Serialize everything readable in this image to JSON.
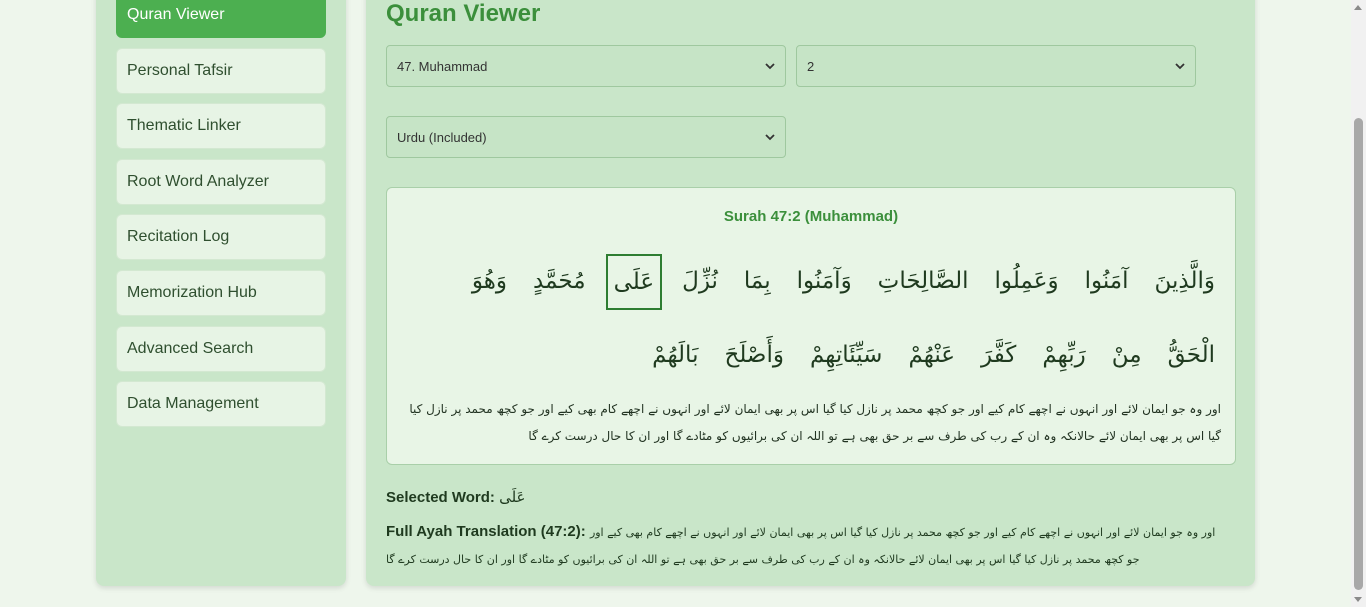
{
  "sidebar": {
    "items": [
      {
        "label": "Quran Viewer",
        "active": true
      },
      {
        "label": "Personal Tafsir",
        "active": false
      },
      {
        "label": "Thematic Linker",
        "active": false
      },
      {
        "label": "Root Word Analyzer",
        "active": false
      },
      {
        "label": "Recitation Log",
        "active": false
      },
      {
        "label": "Memorization Hub",
        "active": false
      },
      {
        "label": "Advanced Search",
        "active": false
      },
      {
        "label": "Data Management",
        "active": false
      }
    ]
  },
  "main": {
    "title": "Quran Viewer",
    "surah_select": {
      "value": "47. Muhammad"
    },
    "ayah_select": {
      "value": "2"
    },
    "translation_select": {
      "value": "Urdu (Included)"
    },
    "ayah_card": {
      "title": "Surah 47:2 (Muhammad)",
      "words": [
        "وَالَّذِينَ",
        "آمَنُوا",
        "وَعَمِلُوا",
        "الصَّالِحَاتِ",
        "وَآمَنُوا",
        "بِمَا",
        "نُزِّلَ",
        "عَلَى",
        "مُحَمَّدٍ",
        "وَهُوَ",
        "الْحَقُّ",
        "مِنْ",
        "رَبِّهِمْ",
        "كَفَّرَ",
        "عَنْهُمْ",
        "سَيِّئَاتِهِمْ",
        "وَأَصْلَحَ",
        "بَالَهُمْ"
      ],
      "selected_index": 7,
      "urdu_translation": "اور وہ جو ایمان لائے اور انہوں نے اچھے کام کیے اور جو کچھ محمد پر نازل کیا گیا اس پر بھی ایمان لائے اور انہوں نے اچھے کام بھی کیے اور جو کچھ محمد پر نازل کیا گیا اس پر بھی ایمان لائے حالانکہ وہ ان کے رب کی طرف سے بر حق بھی ہے تو اللہ ان کی برائیوں کو مٹادے گا اور ان کا حال درست کرے گا"
    },
    "selected_word": {
      "label": "Selected Word:",
      "value": "عَلَى"
    },
    "full_translation": {
      "label": "Full Ayah Translation (47:2):",
      "value": "اور وہ جو ایمان لائے اور انہوں نے اچھے کام کیے اور جو کچھ محمد پر نازل کیا گیا اس پر بھی ایمان لائے اور انہوں نے اچھے کام بھی کیے اور جو کچھ محمد پر نازل کیا گیا اس پر بھی ایمان لائے حالانکہ وہ ان کے رب کی طرف سے بر حق بھی ہے تو اللہ ان کی برائیوں کو مٹادے گا اور ان کا حال درست کرے گا"
    }
  },
  "colors": {
    "accent": "#4caf50",
    "title": "#3b8f3b",
    "panel": "#c9e6c9",
    "card": "#e8f5e6"
  },
  "icons": {
    "select_chevron": "chevron-down-icon"
  }
}
